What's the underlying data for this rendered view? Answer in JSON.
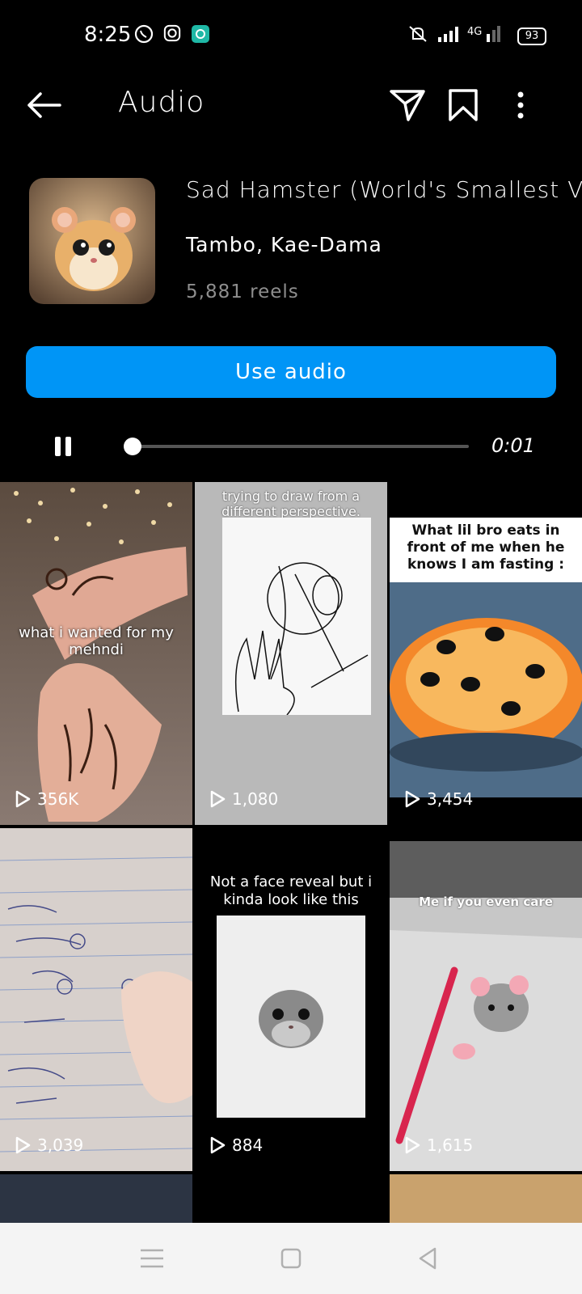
{
  "status_bar": {
    "time": "8:25",
    "network": "4G",
    "battery": "93"
  },
  "header": {
    "title": "Audio"
  },
  "audio": {
    "title": "Sad Hamster (World's Smallest Vio",
    "artist": "Tambo, Kae-Dama",
    "reels_count": "5,881 reels",
    "use_button": "Use audio"
  },
  "player": {
    "elapsed": "0:01",
    "progress": 0.02
  },
  "reels": [
    {
      "caption": "what i wanted for my mehndi",
      "views": "356K"
    },
    {
      "caption": "trying to draw from a different perspective.",
      "views": "1,080"
    },
    {
      "caption": "What lil bro eats in front of me when he knows I am fasting :",
      "views": "3,454"
    },
    {
      "caption": "",
      "views": "3,039"
    },
    {
      "caption": "Not a face reveal but i kinda look like this",
      "views": "884"
    },
    {
      "caption": "Me if you even care",
      "views": "1,615"
    }
  ],
  "colors": {
    "accent": "#0095f6",
    "background": "#000000",
    "muted": "#8e8e8e"
  }
}
